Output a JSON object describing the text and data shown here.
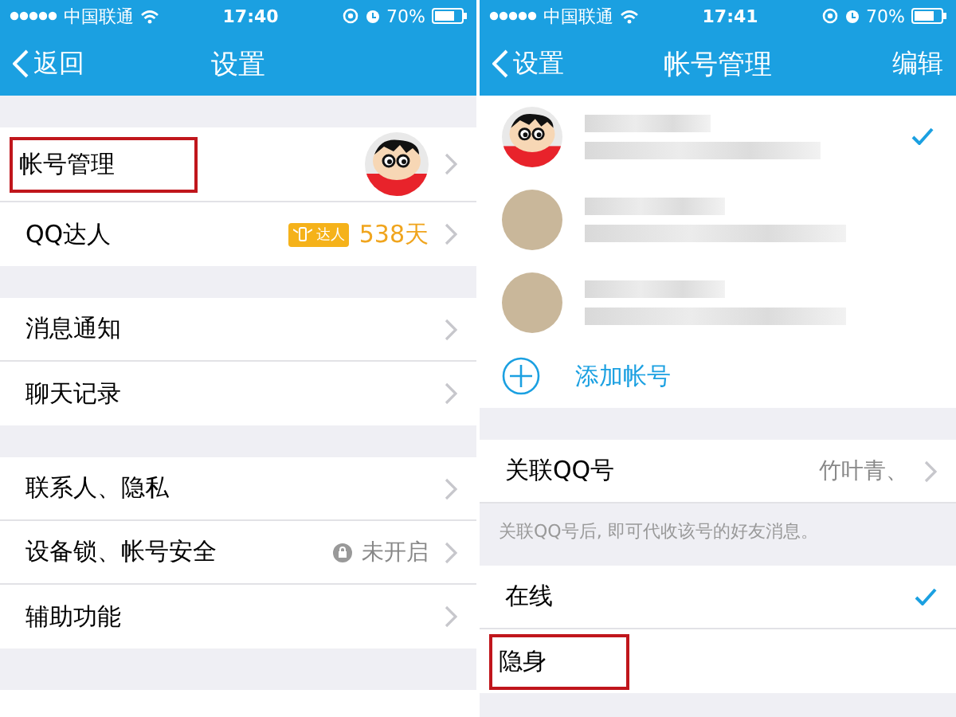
{
  "screens": [
    {
      "status_bar": {
        "carrier": "中国联通",
        "time": "17:40",
        "battery": "70%"
      },
      "nav": {
        "back": "返回",
        "title": "设置"
      },
      "groups": [
        [
          {
            "kind": "avatar",
            "label": "帐号管理",
            "highlighted": true
          },
          {
            "kind": "badge",
            "label": "QQ达人",
            "badge": "达人",
            "value": "538天",
            "highlighted": false
          }
        ],
        [
          {
            "kind": "plain",
            "label": "消息通知",
            "highlighted": false
          },
          {
            "kind": "plain",
            "label": "聊天记录",
            "highlighted": false
          }
        ],
        [
          {
            "kind": "plain",
            "label": "联系人、隐私",
            "highlighted": false
          },
          {
            "kind": "status",
            "label": "设备锁、帐号安全",
            "value": "未开启",
            "highlighted": false
          },
          {
            "kind": "plain",
            "label": "辅助功能",
            "highlighted": false
          }
        ]
      ]
    },
    {
      "status_bar": {
        "carrier": "中国联通",
        "time": "17:41",
        "battery": "70%"
      },
      "nav": {
        "back": "设置",
        "title": "帐号管理",
        "action": "编辑"
      },
      "accounts": [
        {
          "kind": "cartoon",
          "selected": true
        },
        {
          "kind": "photo",
          "selected": false
        },
        {
          "kind": "photo",
          "selected": false
        }
      ],
      "add_account": "添加帐号",
      "linked": {
        "label": "关联QQ号",
        "value": "竹叶青、"
      },
      "note": "关联QQ号后, 即可代收该号的好友消息。",
      "online_status": [
        {
          "label": "在线",
          "selected": true,
          "highlighted": false
        },
        {
          "label": "隐身",
          "selected": false,
          "highlighted": true
        }
      ]
    }
  ]
}
